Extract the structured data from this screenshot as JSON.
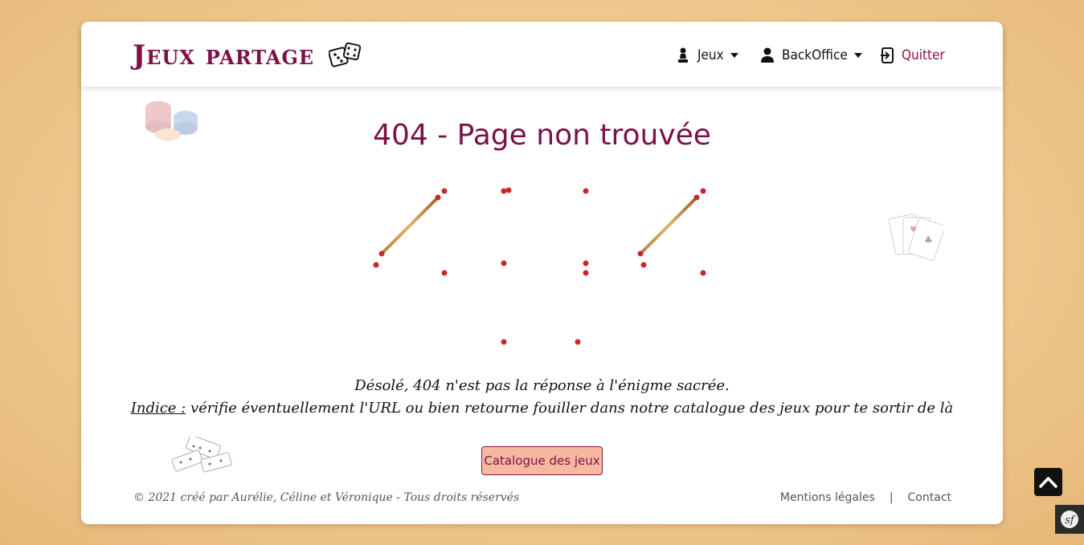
{
  "navbar": {
    "brand": "Jeux partage",
    "dice_icon": "dice-icon",
    "menu": {
      "jeux_label": "Jeux",
      "jeux_icon": "chess-pawn-icon",
      "backoffice_label": "BackOffice",
      "backoffice_icon": "user-icon",
      "quit_label": "Quitter",
      "quit_icon": "sign-out-icon"
    }
  },
  "main": {
    "title": "404 - Page non trouvée",
    "message": "Désolé, 404 n'est pas la réponse à l'énigme sacrée.",
    "hint_label": "Indice :",
    "hint_text": " vérifie éventuellement l'URL ou bien retourne fouiller dans notre catalogue des jeux pour te sortir de là",
    "catalog_button": "Catalogue des jeux"
  },
  "footer": {
    "copyright": "© 2021 créé par Aurélie, Céline et Véronique - Tous droits réservés",
    "legal": "Mentions légales",
    "separator": "|",
    "contact": "Contact"
  },
  "colors": {
    "brand": "#7b1148",
    "button_bg": "#f6b8a0",
    "page_bg": "#efc98f"
  }
}
